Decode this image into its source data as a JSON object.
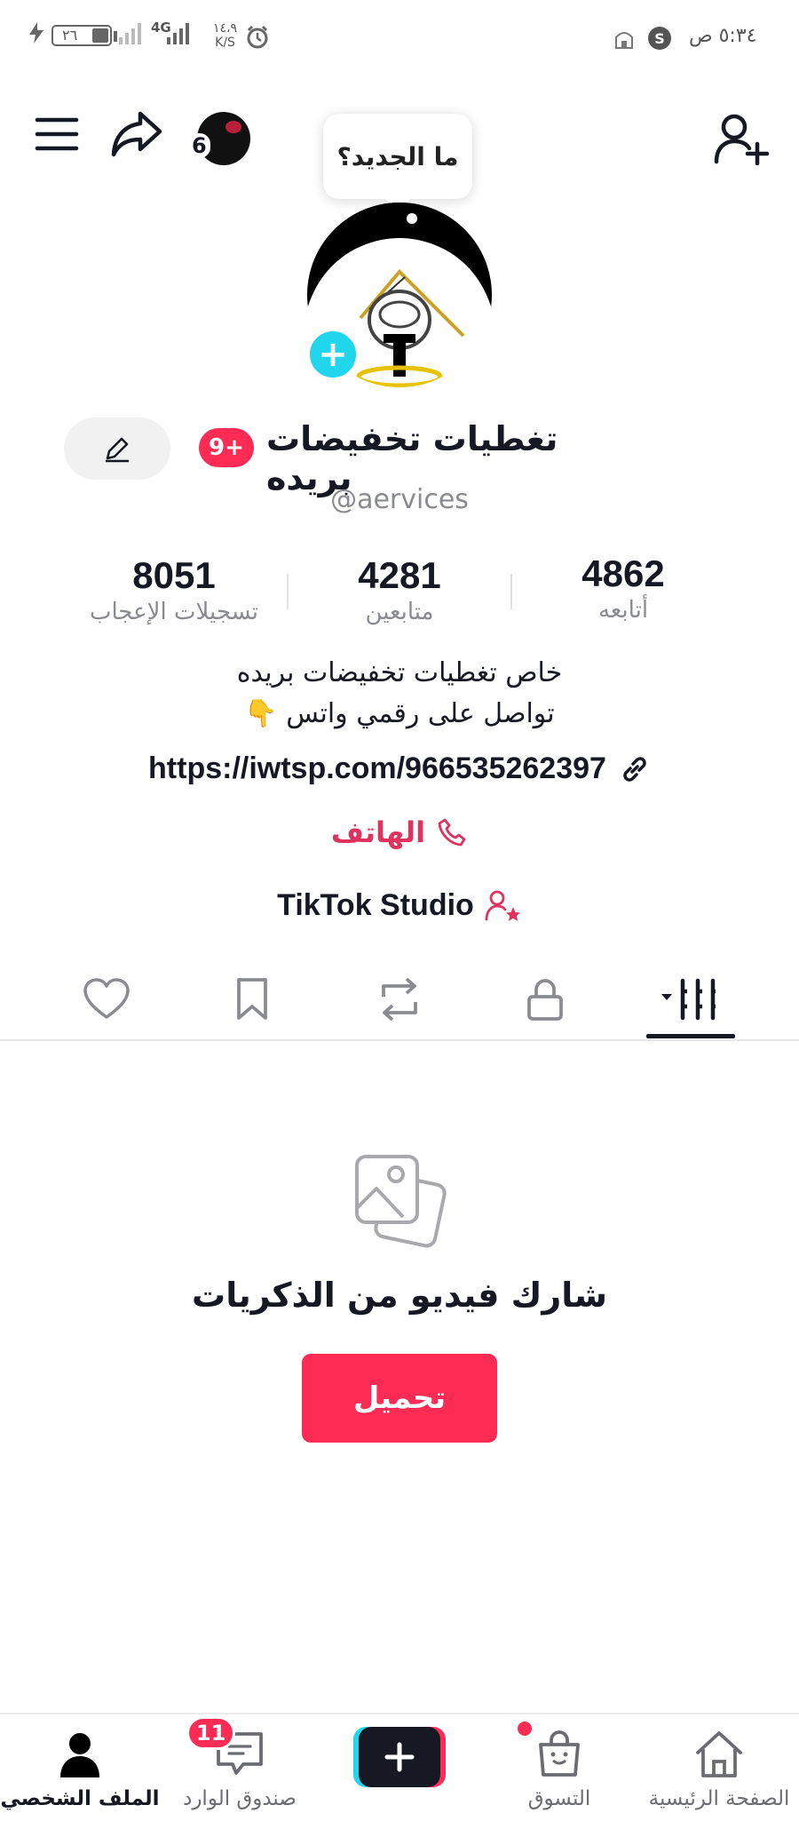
{
  "status_bar": {
    "time": "٥:٣٤ ص",
    "battery": "٢٦",
    "network": "4G",
    "speed_value": "١٤،٩",
    "speed_unit": "K/S"
  },
  "header": {
    "notification_count": "6",
    "tooltip": "ما الجديد؟"
  },
  "profile": {
    "display_name": "تغطيات تخفيضات بريده",
    "badge": "9+",
    "username": "@aervices",
    "stats": [
      {
        "value": "8051",
        "label": "تسجيلات الإعجاب"
      },
      {
        "value": "4281",
        "label": "متابعين"
      },
      {
        "value": "4862",
        "label": "أتابعه"
      }
    ],
    "bio_line1": "خاص تغطيات تخفيضات بريده",
    "bio_line2": "تواصل على رقمي واتس 👇",
    "link": "https://iwtsp.com/966535262397",
    "phone_label": "الهاتف",
    "studio_label": "TikTok Studio"
  },
  "empty_state": {
    "title": "شارك فيديو من الذكريات",
    "button": "تحميل"
  },
  "bottom_nav": {
    "items": [
      {
        "label": "الملف الشخصي",
        "icon": "person-icon"
      },
      {
        "label": "صندوق الوارد",
        "icon": "inbox-icon"
      },
      {
        "label": "",
        "icon": "plus-icon"
      },
      {
        "label": "التسوق",
        "icon": "shopping-bag-icon"
      },
      {
        "label": "الصفحة الرئيسية",
        "icon": "home-icon"
      }
    ],
    "inbox_badge": "11"
  },
  "colors": {
    "accent": "#fe2c55",
    "cyan": "#20d5ec",
    "phone": "#e0325e",
    "text": "#161823",
    "muted": "#8a8b91"
  }
}
